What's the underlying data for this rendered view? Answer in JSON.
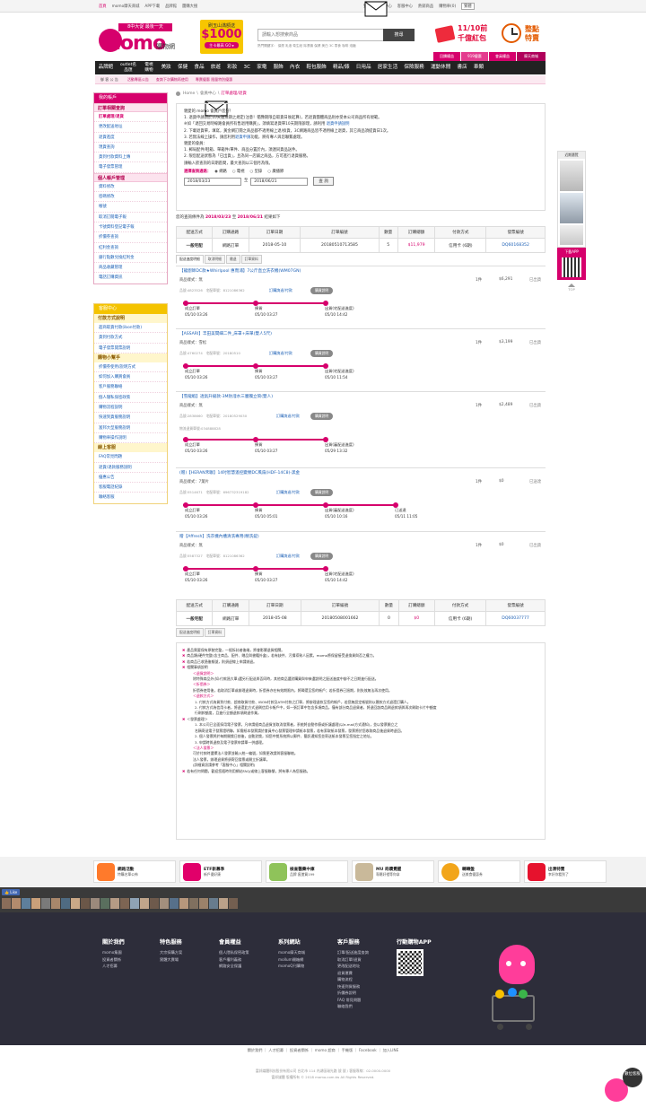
{
  "topbar": {
    "left": [
      "首頁",
      "momo摩天商城",
      "APP下載",
      "品牌館",
      "團購大搜"
    ],
    "right": [
      "登出",
      "會員中心",
      "客服中心",
      "熱銷商品",
      "購物車",
      "購物車(0)",
      "繁體"
    ],
    "home_label": "首頁",
    "mall_label": "momo摩天商城",
    "app_label": "APP下載",
    "brand_label": "品牌館",
    "deal_label": "團購大搜",
    "logout_label": "登出",
    "member_label": "會員中心",
    "service_label": "客服中心",
    "hot_label": "熱銷商品",
    "cart_label": "購物車(0)",
    "lang_label": "繁體"
  },
  "header": {
    "logo_text": "momo",
    "logo_sub": "購物網",
    "logo_slogan": "8中大促 最後一天",
    "ad_center_line1": "刷玉山滿額送",
    "ad_center_amount": "$1000",
    "ad_center_line2": "主卡最高 GO ▸",
    "search_placeholder": "請輸入想搜索商品",
    "search_button": "搜尋",
    "hot_keywords": "熱門關鍵字：  保濕  乳液  衛生紙  除濕機  保健  美白  3C  零食  咖啡  泡麵",
    "ad_right1_line1": "11/10前",
    "ad_right1_line2": "千億紅包",
    "ad_right2_line1": "整點",
    "ad_right2_line2": "特賣"
  },
  "nav": {
    "items": [
      "品牌館",
      "outlet名品匯",
      "電視購物",
      "美妝",
      "保健",
      "食品",
      "旅遊",
      "彩妝",
      "3C",
      "家電",
      "服飾",
      "內衣",
      "鞋包服飾",
      "精品/錶",
      "日用品",
      "居家生活",
      "保險服務",
      "運動休閒",
      "書店",
      "車類",
      "保險"
    ],
    "right": [
      "回饋權益",
      "919優惠",
      "會員權益",
      "摩天商城"
    ]
  },
  "subbar": {
    "items": [
      "活動專區公告",
      "查詢下次購物再使用",
      "專賣優惠 限量特別優惠"
    ]
  },
  "sidebar": {
    "account_title": "我的帳戶",
    "order_section": "訂單相關查詢",
    "order_items": [
      "訂單處理/退貨",
      "更改配送地址",
      "退貨進度",
      "現貨查詢",
      "貨到付款資料上傳",
      "電子發票管理"
    ],
    "profile_section": "個人帳戶管理",
    "profile_items": [
      "資料修改",
      "密碼修改",
      "帳號",
      "取消訂閱電子報",
      "卡號資料登記電子報",
      "折價券查詢",
      "紅利金查詢",
      "銀行點數兌換紅利金",
      "商品收藏管理",
      "電話訂購資訊"
    ],
    "service_title": "客服中心",
    "pay_section": "付款方式說明",
    "pay_items": [
      "超商取貨付款(ibon付款)",
      "貨到付款方式",
      "電子發票開票說明"
    ],
    "help_section": "購物小幫手",
    "help_items": [
      "折價券使用/說明方式",
      "如何加入購買會員",
      "客戶服務聯絡",
      "個人隱私保密政策",
      "購物流程說明",
      "快速到貨服務說明",
      "富邦大型服務說明",
      "購物車操作說明"
    ],
    "online_section": "線上客服",
    "online_items": [
      "FAQ常見問題",
      "退貨/退款服務說明",
      "優惠公告",
      "客服電話紀錄",
      "聯絡客服"
    ]
  },
  "breadcrumb": {
    "home": "Home",
    "member": "會員中心",
    "current": "訂單處理/退貨"
  },
  "notice": {
    "greeting": "親愛的 momo 會員戶您好！",
    "lines": [
      "1. 退貨申請須於10天猶豫期之規定(注意！猶豫期限自取貨日後起算)，若退貨團體商品則亦受本公司商品所有規範。",
      "   ※如「退回交易時線路會員所有售退用購買」，須填寫退貨單10天期限辦理，請利用",
      "2. 下載退貨單，填寫，黃金網訂閱之商品都不適用線上退/換貨，3C網路商品皆不適用線上退貨，其它商品須提貨日1次。",
      "3. 若無法線上操作，請您利用",
      "親愛的會員：",
      "1. 郵局配件/鞋箱、單箱件/單件、商品分置於內，須連同貨品送件。",
      "2. 限您配送狀態為「已出貨」，且為同一店鋪之商品，方可進行退貨服務。",
      "請輸入欲查詢的日期區間，最大查詢以三個月為限。"
    ],
    "link1": "退貨申請說明",
    "link2": "退貨申請",
    "tail3": "功能，將有專人與您聯繫處理。",
    "period_label": "選擇查詢通路：",
    "channels": [
      "網路",
      "電視",
      "型錄",
      "廣播節"
    ],
    "date_from": "2018/03/23",
    "date_to": "2018/06/21",
    "to_label": "至",
    "query_button": "查 詢"
  },
  "result": {
    "prefix": "您的查詢條件為",
    "from": "2018/03/23",
    "mid": "至",
    "to": "2018/06/21",
    "suffix": "結果如下"
  },
  "table_headers": [
    "配送方式",
    "訂購通路",
    "訂單日期",
    "訂單編號",
    "數量",
    "訂購總額",
    "付款方式",
    "發票編號"
  ],
  "orders": [
    {
      "ship": "一般宅配",
      "channel": "網路訂單",
      "date": "2018-05-10",
      "no": "20180510713585",
      "qty": "5",
      "total": "$11,979",
      "pay": "信用卡 (6期)",
      "invoice": "DQ60168352"
    },
    {
      "ship": "一般宅配",
      "channel": "網路訂單",
      "date": "2018-05-08",
      "no": "20180508001662",
      "qty": "0",
      "total": "$0",
      "pay": "信用卡 (6期)",
      "invoice": "DQ60037777"
    }
  ],
  "tabs": [
    "配送進度明細",
    "取消明細",
    "繳退",
    "訂單資料"
  ],
  "tabs2": [
    "配送進度明細",
    "訂單資料"
  ],
  "items": [
    {
      "name": "【龍廚師DC款★Whirlpool 惠而浦】7公斤直立洗衣機(WM07GN)",
      "spec": "商品樣式：無",
      "code": "品號:4823526　宅配單號：8121086362",
      "qty": "1件",
      "price": "$6,291",
      "status": "已出貨",
      "link": "訂購詢退/付款",
      "pill": "購買說明",
      "steps": [
        "成立訂單",
        "揀貨",
        "出貨(宅配送進度)"
      ],
      "times": [
        "05/10 03:26",
        "05/10 03:27",
        "05/10 14:42"
      ]
    },
    {
      "name": "【ASSARI】丰田美間細二件_床罩+床單(雙人5尺)",
      "spec": "商品樣式：雪松",
      "code": "品號:4760274　宅配單號：20180510",
      "qty": "1件",
      "price": "$3,199",
      "status": "已出貨",
      "link": "訂購詢退/付款",
      "pill": "購買說明",
      "steps": [
        "成立訂單",
        "揀貨",
        "出貨(宅配送進度)"
      ],
      "times": [
        "05/10 03:26",
        "05/10 03:27",
        "05/10 11:54"
      ]
    },
    {
      "name": "【雪龍蝦】透氣升級款-3M防潑水三層獨立筒(雙人)",
      "spec": "商品樣式：無",
      "code": "品號:2838660　宅配單號：20180529030",
      "code2": "物流退貨單號:034888828",
      "qty": "1件",
      "price": "$2,489",
      "status": "已出貨",
      "link": "訂購詢退/付款",
      "pill": "購買說明",
      "steps": [
        "成立訂單",
        "揀貨",
        "出貨(審配送進度)"
      ],
      "times": [
        "05/10 03:26",
        "05/10 03:27",
        "05/29 13:32"
      ]
    },
    {
      "name": "(贈)【HERAN禾聯】14吋智慧遙控變頻DC風扇(HDF-14C8)-黑金",
      "spec": "商品樣式：7葉片",
      "code": "品號:5514671　宅配單號：696732319182",
      "qty": "1件",
      "price": "$0",
      "status": "已送達",
      "link": "訂購詢退/付款",
      "pill": "購買說明",
      "steps": [
        "成立訂單",
        "揀貨",
        "出貨(審配送進度)",
        "已送達"
      ],
      "times": [
        "05/10 03:26",
        "05/10 05:01",
        "05/10 10:16",
        "05/11 11:05"
      ]
    },
    {
      "name": "贈【Affresh】洗衣機內槽清洗專用(精洗錠)",
      "spec": "商品樣式：無",
      "code": "品號:5587327　宅配單號：8121086362",
      "qty": "1件",
      "price": "$0",
      "status": "已出貨",
      "link": "訂購詢退/付款",
      "pill": "購買說明",
      "steps": [
        "成立訂單",
        "揀貨",
        "出貨(宅配送進度)"
      ],
      "times": [
        "05/10 03:26",
        "05/10 03:27",
        "05/10 14:42"
      ]
    }
  ],
  "bottom_notice": {
    "lines": [
      "產品需要保有原裝完整，一經拆封者後端，將會影響退貨相關。",
      "商品類/硬件完整(含主商品、配件、贈品與書籍外盒)，若有缺件、污損導致人因素，momo將保留接受退換貨與否之權力。",
      "若商品已收過後報號，則須退線上申請辦退。",
      "相關事項說明",
      "＜退貨說明＞",
      "除特殊商品外(如:付款過大單)選另行配送與否同時，其他商品選對購買與申來選說明之配送進度中辦不之日期進行配送。",
      "＜折價券＞",
      "折價券使用後，若取消訂單或辦理退貨時，折價券亦在有效期限內，將歸還至您的帳戶；若折價券已過期，則失效無法再次使用。",
      "＜退款方式＞",
      "1. 付款方式為貨到付款、超商取貨付款、IBON付款及ATM付款之訂單，將辦理退款至您的帳戶，若您無設定帳號則以匯款方式退還訂購人。",
      "2. 付款方式為信用卡者，將退還此方式退刷信用卡帳戶中，如一張訂單中包含多項商品，僅有部分商品退貨者，將退回該商品刷退款項與再次刷取卡片中額度",
      "   行刷款額度，且進行全額退款項刷退作業。",
      "＜發票處理＞",
      "1. 本公司已全面採用電子發票，凡申請經商品退貨並取消發票者，系統將自動作廢或折讓處理(以e-mail方式通知)，並以發票開立之",
      "   名稱寄送電子發票證明聯，如需紙本發票請於會員中心發票管理申請紙本發票，若有索取紙本發票，發票將於您收取商品後退貨時退回。",
      "2. 個人發票將於每期開獎日前後，自動對獎，如您中獎系統將以郵件、簡訊通知您並寄送紙本發票至您指定之地址。",
      "3. 申請時與退款及電子發票申請單一併處理。",
      "＜法人發票＞",
      "可於付款時選擇法人發票並輸入統一編號，如需更改請與客服聯絡。",
      "法人發票，辦理退貨將須寄回發票或開立折讓單。",
      "若有任何問題，歡迎您隨時利用網站FAQ/或線上客服聯繫，將有專人為您服務。"
    ],
    "fine_print": "(詳細資訊請參考「客服中心」相關說明)"
  },
  "right_rail": {
    "label1": "近期瀏覽",
    "label2": "下載APP",
    "top": "TOP"
  },
  "footer_banners": [
    {
      "t1": "網路活動",
      "t2": "特購名單公佈"
    },
    {
      "t1": "ETF新募季",
      "t2": "新戶優好康"
    },
    {
      "t1": "檢查醫藥中庫",
      "t2": "品牌 瘋搶買199"
    },
    {
      "t1": "MU 奇蹟覺醒",
      "t2": "專屬好禮等你拿"
    },
    {
      "t1": "轉轉盤",
      "t2": "送美食優惠券"
    },
    {
      "t1": "出清特賣",
      "t2": "幸好你看到了"
    }
  ],
  "fb_like": "Like",
  "footer_cols": [
    {
      "h": "關於我們",
      "l": [
        "momo集團",
        "投資者關係",
        "人才招募"
      ]
    },
    {
      "h": "特色服務",
      "l": [
        "大宗採購方案",
        "實體大賣場"
      ]
    },
    {
      "h": "會員權益",
      "l": [
        "個人隱私保密政策",
        "客戶權利義務",
        "網路安全保護"
      ]
    },
    {
      "h": "系列網站",
      "l": [
        "momo摩天商城",
        "mollum開箱網",
        "momoQ刊購物"
      ]
    },
    {
      "h": "客戶服務",
      "l": [
        "訂單/配送進度查詢",
        "取消訂單/退貨",
        "更改配送地址",
        "退貨運費",
        "購物流程",
        "快速到貨服務",
        "折價券說明",
        "FAQ 常見問題",
        "聯絡我們"
      ]
    },
    {
      "h": "行動購物APP",
      "l": []
    }
  ],
  "footer_links": [
    "關於我們",
    "人才招募",
    "投資者關係",
    "momo 超商",
    "手機版",
    "Facebook",
    "加入LINE"
  ],
  "copyright_line1": "富邦媒體科技股份有限公司 台北市 114 內湖區瑞光路 號 號 / 客服專線：02-0000-0000",
  "copyright_line2": "富邦媒體 版權所有 © 2018 momo.com.tw All Rights Reserved.",
  "float_service": "數位客服",
  "colors": {
    "brand": "#d6006c",
    "nav": "#222222",
    "link": "#1b5fb5",
    "yellow": "#f4c300",
    "footer": "#2d2d3a"
  }
}
